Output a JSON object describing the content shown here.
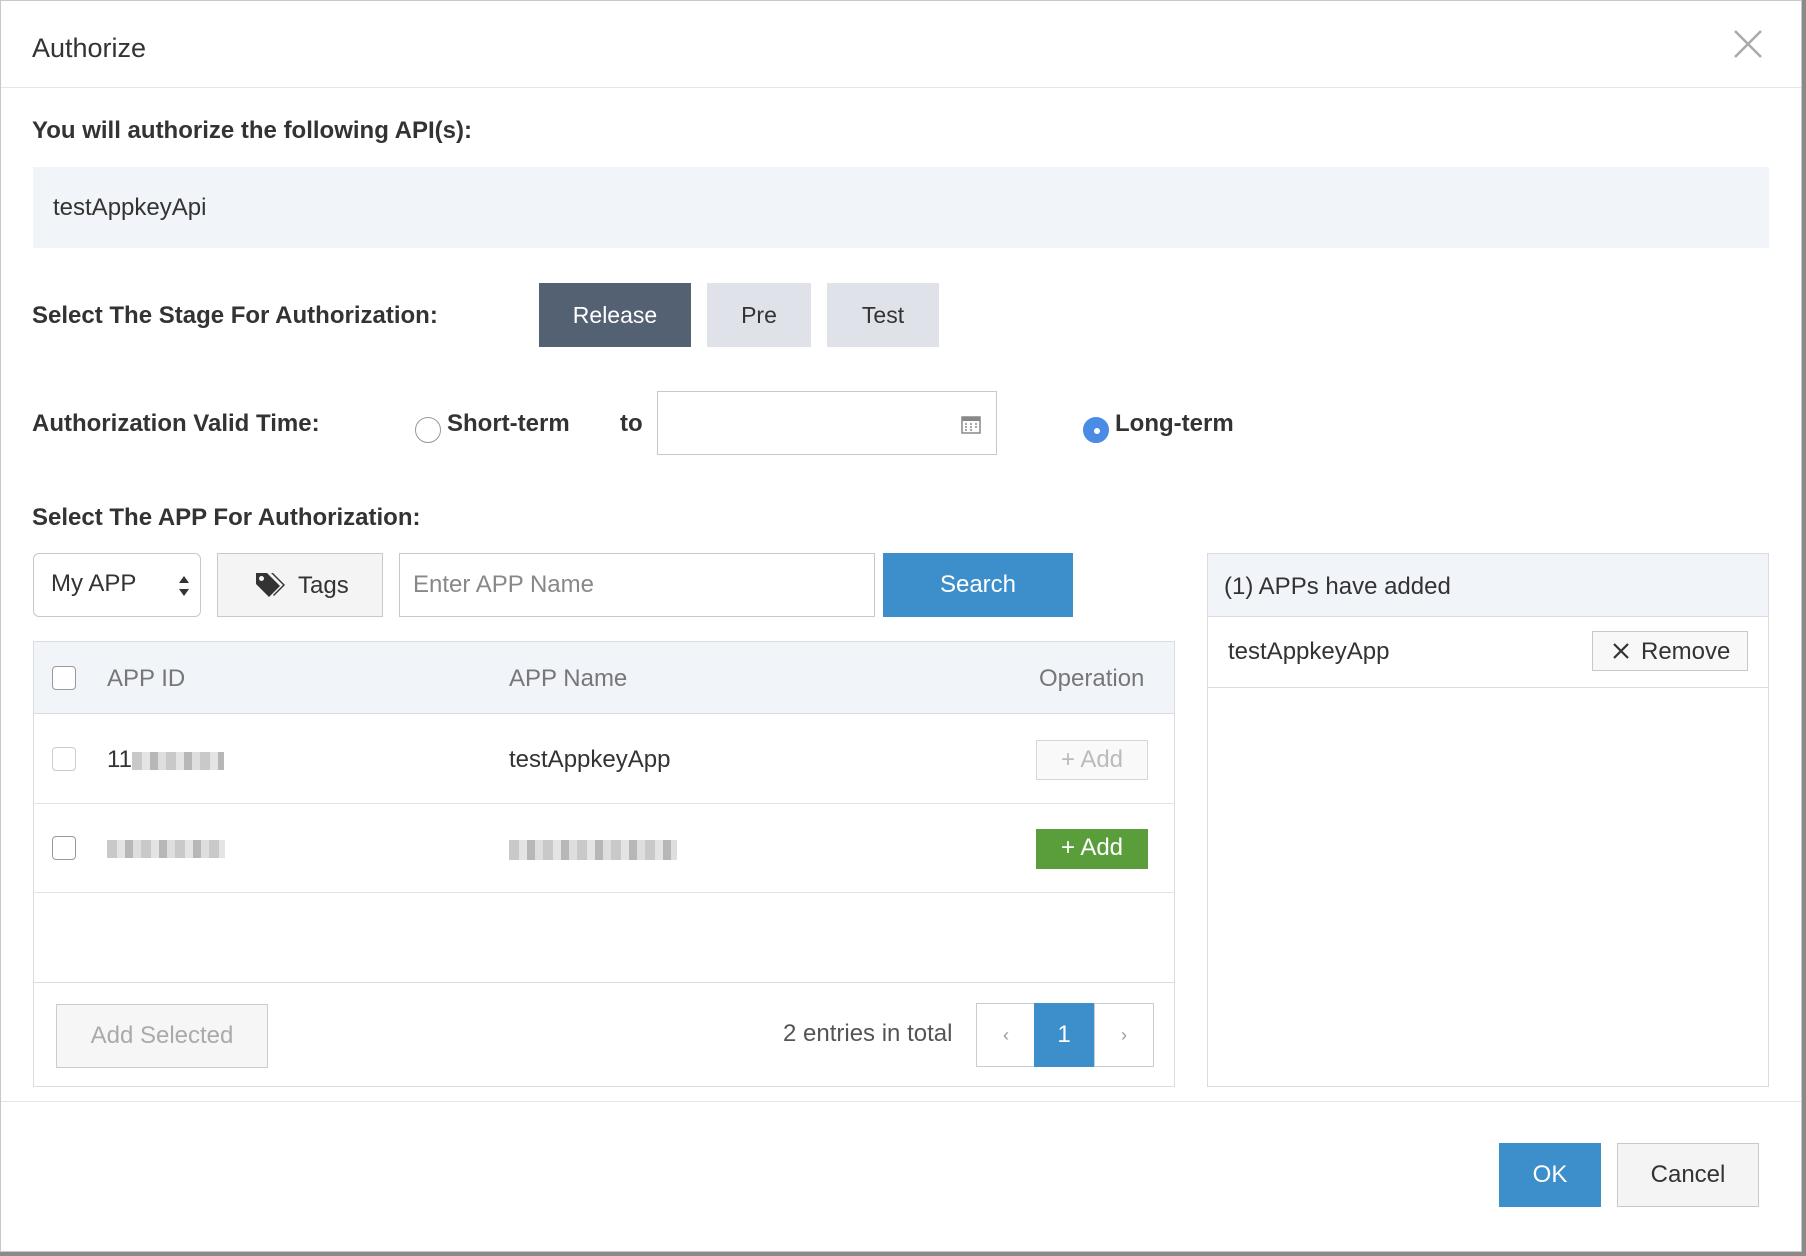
{
  "dialog": {
    "title": "Authorize"
  },
  "api_section": {
    "label": "You will authorize the following API(s):",
    "api_name": "testAppkeyApi"
  },
  "stage": {
    "label": "Select The Stage For Authorization:",
    "options": [
      "Release",
      "Pre",
      "Test"
    ],
    "selected": "Release"
  },
  "valid_time": {
    "label": "Authorization Valid Time:",
    "short_term_label": "Short-term",
    "to_label": "to",
    "long_term_label": "Long-term",
    "selected": "Long-term",
    "date_value": ""
  },
  "app_section": {
    "label": "Select The APP For Authorization:",
    "scope_select": "My APP",
    "tags_label": "Tags",
    "search_placeholder": "Enter APP Name",
    "search_label": "Search"
  },
  "table": {
    "columns": [
      "APP ID",
      "APP Name",
      "Operation"
    ],
    "rows": [
      {
        "app_id": "11",
        "app_name": "testAppkeyApp",
        "add_label": "+ Add",
        "state": "added"
      },
      {
        "app_id": "",
        "app_name": "",
        "add_label": "+ Add",
        "state": "available"
      }
    ],
    "add_selected_label": "Add Selected",
    "total_text": "2 entries in total",
    "pagination": {
      "prev": "‹",
      "current": "1",
      "next": "›"
    }
  },
  "added_panel": {
    "title": "(1) APPs have added",
    "items": [
      {
        "name": "testAppkeyApp",
        "remove_label": "Remove"
      }
    ]
  },
  "footer": {
    "ok_label": "OK",
    "cancel_label": "Cancel"
  }
}
